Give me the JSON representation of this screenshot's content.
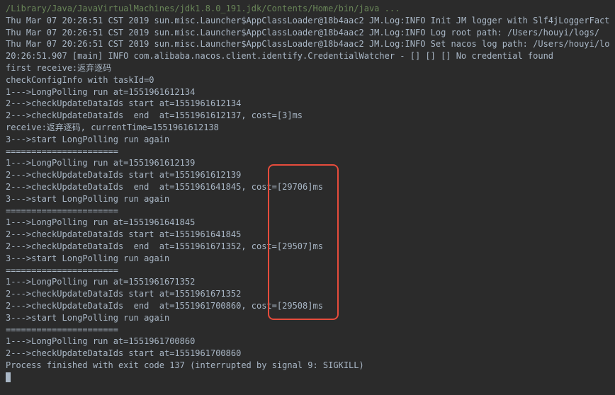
{
  "path_line": "/Library/Java/JavaVirtualMachines/jdk1.8.0_191.jdk/Contents/Home/bin/java ...",
  "log_lines": [
    "Thu Mar 07 20:26:51 CST 2019 sun.misc.Launcher$AppClassLoader@18b4aac2 JM.Log:INFO Init JM logger with Slf4jLoggerFact",
    "Thu Mar 07 20:26:51 CST 2019 sun.misc.Launcher$AppClassLoader@18b4aac2 JM.Log:INFO Log root path: /Users/houyi/logs/",
    "Thu Mar 07 20:26:51 CST 2019 sun.misc.Launcher$AppClassLoader@18b4aac2 JM.Log:INFO Set nacos log path: /Users/houyi/lo",
    "20:26:51.907 [main] INFO com.alibaba.nacos.client.identify.CredentialWatcher - [] [] [] No credential found",
    "first receive:返弃逐码",
    "checkConfigInfo with taskId=0",
    "1--->LongPolling run at=1551961612134",
    "2--->checkUpdateDataIds start at=1551961612134",
    "2--->checkUpdateDataIds  end  at=1551961612137, cost=[3]ms",
    "receive:返弃逐码, currentTime=1551961612138",
    "3--->start LongPolling run again",
    "======================",
    "1--->LongPolling run at=1551961612139",
    "2--->checkUpdateDataIds start at=1551961612139",
    "2--->checkUpdateDataIds  end  at=1551961641845, cost=[29706]ms",
    "3--->start LongPolling run again",
    "======================",
    "1--->LongPolling run at=1551961641845",
    "2--->checkUpdateDataIds start at=1551961641845",
    "2--->checkUpdateDataIds  end  at=1551961671352, cost=[29507]ms",
    "3--->start LongPolling run again",
    "======================",
    "1--->LongPolling run at=1551961671352",
    "2--->checkUpdateDataIds start at=1551961671352",
    "2--->checkUpdateDataIds  end  at=1551961700860, cost=[29508]ms",
    "3--->start LongPolling run again",
    "======================",
    "1--->LongPolling run at=1551961700860",
    "2--->checkUpdateDataIds start at=1551961700860",
    "",
    "Process finished with exit code 137 (interrupted by signal 9: SIGKILL)"
  ]
}
